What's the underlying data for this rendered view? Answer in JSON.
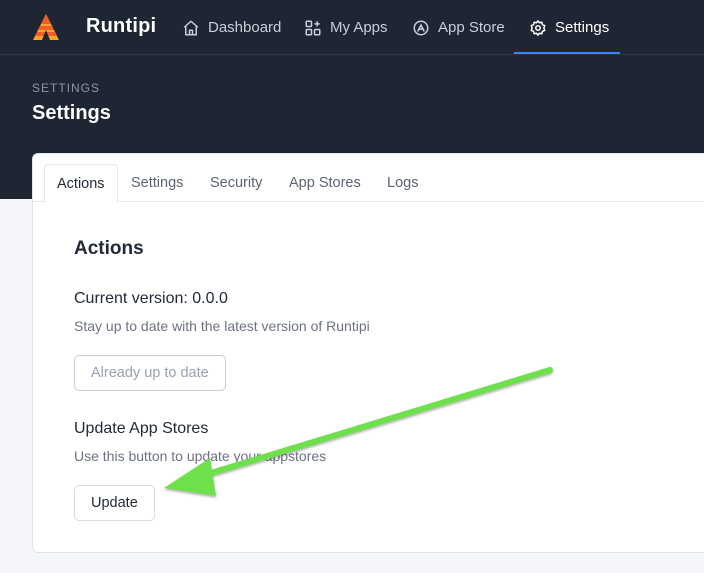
{
  "app": {
    "brand": "Runtipi"
  },
  "nav": {
    "items": [
      {
        "label": "Dashboard",
        "icon": "home-icon",
        "active": false
      },
      {
        "label": "My Apps",
        "icon": "apps-icon",
        "active": false
      },
      {
        "label": "App Store",
        "icon": "app-store-icon",
        "active": false
      },
      {
        "label": "Settings",
        "icon": "gear-icon",
        "active": true
      }
    ]
  },
  "header": {
    "pretitle": "SETTINGS",
    "title": "Settings"
  },
  "tabs": [
    {
      "label": "Actions",
      "active": true
    },
    {
      "label": "Settings",
      "active": false
    },
    {
      "label": "Security",
      "active": false
    },
    {
      "label": "App Stores",
      "active": false
    },
    {
      "label": "Logs",
      "active": false
    }
  ],
  "actions": {
    "title": "Actions",
    "version_heading": "Current version: 0.0.0",
    "version_desc": "Stay up to date with the latest version of Runtipi",
    "version_button": "Already up to date",
    "update_heading": "Update App Stores",
    "update_desc": "Use this button to update your appstores",
    "update_button": "Update"
  },
  "colors": {
    "topbar": "#1e2533",
    "accent": "#3b82f6",
    "annotation_arrow": "#6ee04b"
  }
}
